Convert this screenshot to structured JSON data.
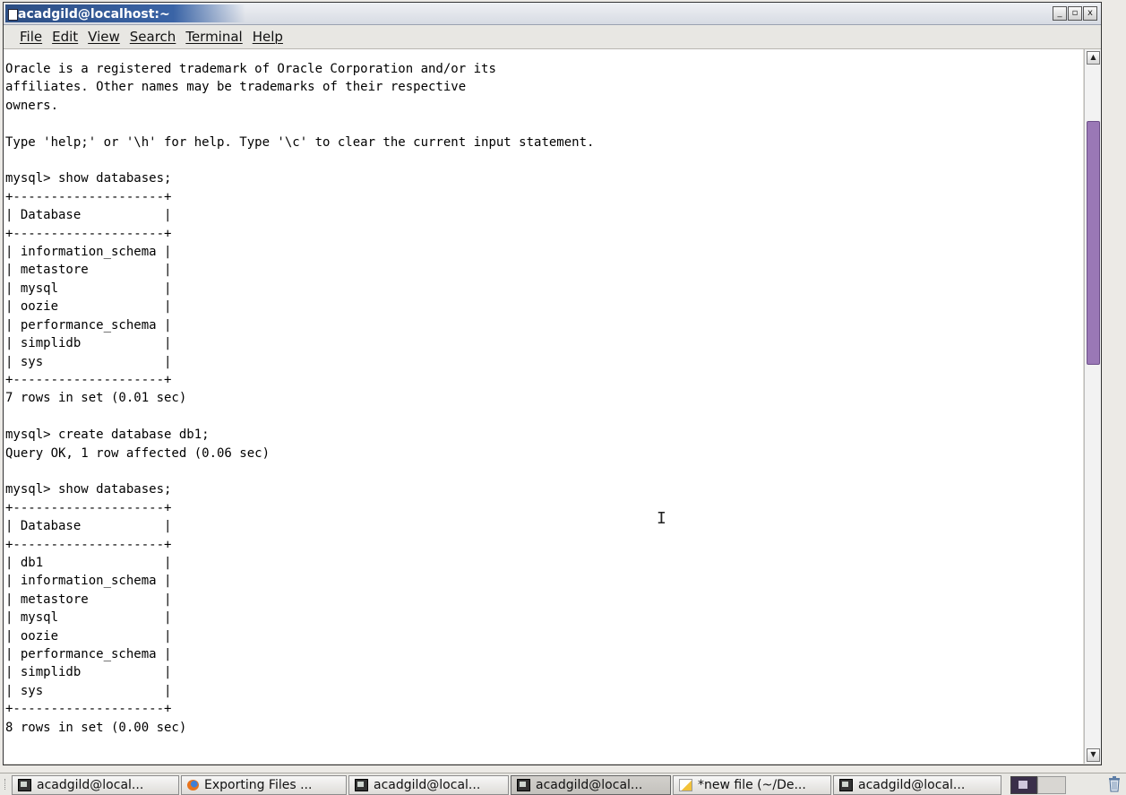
{
  "window": {
    "title": "acadgild@localhost:~",
    "controls": [
      "_",
      "▫",
      "x"
    ]
  },
  "menu": [
    "File",
    "Edit",
    "View",
    "Search",
    "Terminal",
    "Help"
  ],
  "terminal": {
    "text": "Oracle is a registered trademark of Oracle Corporation and/or its\naffiliates. Other names may be trademarks of their respective\nowners.\n\nType 'help;' or '\\h' for help. Type '\\c' to clear the current input statement.\n\nmysql> show databases;\n+--------------------+\n| Database           |\n+--------------------+\n| information_schema |\n| metastore          |\n| mysql              |\n| oozie              |\n| performance_schema |\n| simplidb           |\n| sys                |\n+--------------------+\n7 rows in set (0.01 sec)\n\nmysql> create database db1;\nQuery OK, 1 row affected (0.06 sec)\n\nmysql> show databases;\n+--------------------+\n| Database           |\n+--------------------+\n| db1                |\n| information_schema |\n| metastore          |\n| mysql              |\n| oozie              |\n| performance_schema |\n| simplidb           |\n| sys                |\n+--------------------+\n8 rows in set (0.00 sec)"
  },
  "taskbar": {
    "buttons": [
      {
        "label": "acadgild@local...",
        "icon": "terminal-icon"
      },
      {
        "label": "Exporting Files ...",
        "icon": "firefox-icon"
      },
      {
        "label": "acadgild@local...",
        "icon": "terminal-icon"
      },
      {
        "label": "acadgild@local...",
        "icon": "terminal-icon"
      },
      {
        "label": "*new file (~/De...",
        "icon": "text-editor-icon"
      },
      {
        "label": "acadgild@local...",
        "icon": "terminal-icon"
      }
    ]
  },
  "colors": {
    "title_bar": "#2c4e84",
    "scroll_thumb": "#9a78b6",
    "terminal_bg": "#ffffff"
  }
}
